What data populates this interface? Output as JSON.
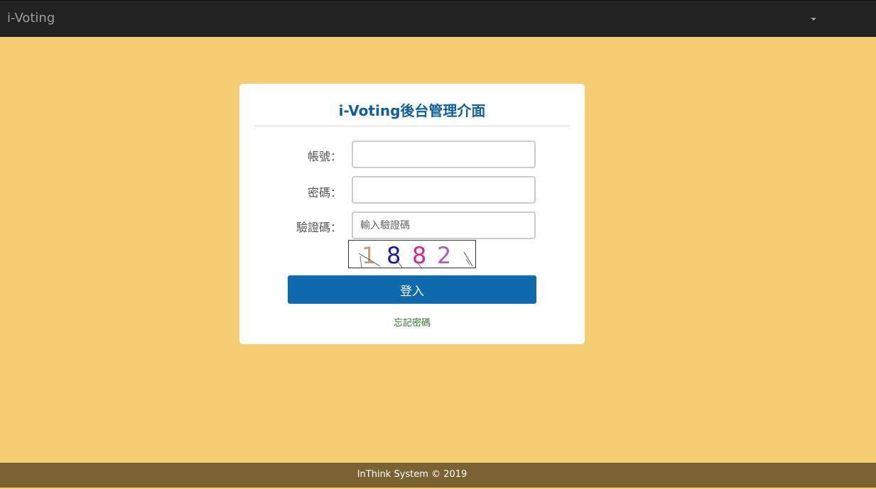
{
  "navbar": {
    "brand": "i-Voting"
  },
  "panel": {
    "title_brand": "i-Voting",
    "title_suffix": "後台管理介面"
  },
  "form": {
    "account_label": "帳號：",
    "account_value": "",
    "password_label": "密碼：",
    "password_value": "",
    "captcha_label": "驗證碼：",
    "captcha_placeholder": "輸入驗證碼",
    "captcha_digits": [
      "1",
      "8",
      "8",
      "2"
    ],
    "captcha_colors": [
      "#c9997d",
      "#1a1aa0",
      "#d8258f",
      "#b15bbd"
    ],
    "login_label": "登入",
    "forgot_label": "忘記密碼"
  },
  "footer": {
    "text": "InThink System © 2019"
  },
  "colors": {
    "background": "#f5cd72",
    "navbar": "#222222",
    "footer": "#7b6232",
    "primary_button": "#0e6aad",
    "title": "#0f5f9e",
    "forgot_link": "#2a7a1a"
  }
}
